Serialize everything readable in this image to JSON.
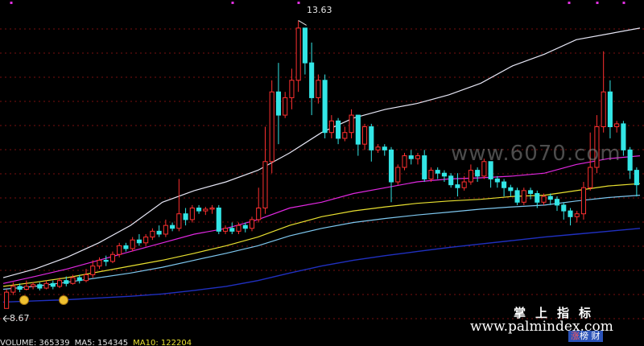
{
  "chart_data": {
    "type": "candlestick",
    "title": "",
    "xlabel": "",
    "ylabel": "",
    "ylim": [
      8.3,
      13.9
    ],
    "price_labels": {
      "high": "13.63",
      "low": "8.67"
    },
    "colors": {
      "up": "#ff3030",
      "down": "#33e6e6",
      "ma_white": "#e6e6f5",
      "ma_magenta": "#e028e0",
      "ma_yellow": "#e8e030",
      "ma_lightblue": "#7ec8f0",
      "ma_navy": "#2030c0",
      "grid": "#7a1010",
      "marker": "#e030e0"
    },
    "candles": [
      [
        8.67,
        8.95,
        8.67,
        9.0
      ],
      [
        8.95,
        9.05,
        8.9,
        9.12
      ],
      [
        9.05,
        9.0,
        8.95,
        9.1
      ],
      [
        9.0,
        9.05,
        8.98,
        9.15
      ],
      [
        9.05,
        9.08,
        9.0,
        9.12
      ],
      [
        9.08,
        9.02,
        8.98,
        9.12
      ],
      [
        9.02,
        9.1,
        9.0,
        9.15
      ],
      [
        9.1,
        9.05,
        9.0,
        9.15
      ],
      [
        9.05,
        9.15,
        9.02,
        9.2
      ],
      [
        9.15,
        9.1,
        9.05,
        9.22
      ],
      [
        9.1,
        9.2,
        9.08,
        9.25
      ],
      [
        9.2,
        9.15,
        9.1,
        9.25
      ],
      [
        9.15,
        9.25,
        9.12,
        9.35
      ],
      [
        9.25,
        9.4,
        9.2,
        9.5
      ],
      [
        9.4,
        9.5,
        9.35,
        9.55
      ],
      [
        9.5,
        9.48,
        9.4,
        9.58
      ],
      [
        9.48,
        9.6,
        9.45,
        9.65
      ],
      [
        9.6,
        9.75,
        9.55,
        9.8
      ],
      [
        9.75,
        9.7,
        9.65,
        9.8
      ],
      [
        9.7,
        9.85,
        9.65,
        9.9
      ],
      [
        9.85,
        9.8,
        9.75,
        9.95
      ],
      [
        9.8,
        9.9,
        9.75,
        9.95
      ],
      [
        9.9,
        10.0,
        9.85,
        10.05
      ],
      [
        10.0,
        9.95,
        9.9,
        10.1
      ],
      [
        9.95,
        10.1,
        9.9,
        10.2
      ],
      [
        10.1,
        10.05,
        10.0,
        10.15
      ],
      [
        10.05,
        10.3,
        10.0,
        10.9
      ],
      [
        10.3,
        10.2,
        10.1,
        10.4
      ],
      [
        10.2,
        10.4,
        10.15,
        10.45
      ],
      [
        10.4,
        10.35,
        10.3,
        10.45
      ],
      [
        10.35,
        10.38,
        10.28,
        10.42
      ],
      [
        10.38,
        10.4,
        10.3,
        10.45
      ],
      [
        10.4,
        10.0,
        9.95,
        10.45
      ],
      [
        10.0,
        10.05,
        9.95,
        10.1
      ],
      [
        10.05,
        10.0,
        9.95,
        10.15
      ],
      [
        10.0,
        10.1,
        9.95,
        10.15
      ],
      [
        10.1,
        10.05,
        9.98,
        10.15
      ],
      [
        10.05,
        10.2,
        10.0,
        10.25
      ],
      [
        10.2,
        10.4,
        10.15,
        10.75
      ],
      [
        10.4,
        11.2,
        10.3,
        11.8
      ],
      [
        11.2,
        12.4,
        11.0,
        12.6
      ],
      [
        12.4,
        12.0,
        11.5,
        12.9
      ],
      [
        12.0,
        12.3,
        11.95,
        12.4
      ],
      [
        12.3,
        12.6,
        12.1,
        12.8
      ],
      [
        12.6,
        13.5,
        12.4,
        13.63
      ],
      [
        13.5,
        12.9,
        12.7,
        13.3
      ],
      [
        12.9,
        12.3,
        12.0,
        13.25
      ],
      [
        12.3,
        12.6,
        12.2,
        12.7
      ],
      [
        12.6,
        11.7,
        11.6,
        12.7
      ],
      [
        11.7,
        11.9,
        11.6,
        12.0
      ],
      [
        11.9,
        11.6,
        11.5,
        11.95
      ],
      [
        11.6,
        11.7,
        11.55,
        11.8
      ],
      [
        11.7,
        12.0,
        11.6,
        12.1
      ],
      [
        12.0,
        11.5,
        11.3,
        12.0
      ],
      [
        11.5,
        11.8,
        11.4,
        11.85
      ],
      [
        11.8,
        11.4,
        11.2,
        11.85
      ],
      [
        11.4,
        11.45,
        11.35,
        11.5
      ],
      [
        11.45,
        11.4,
        11.3,
        11.5
      ],
      [
        11.4,
        10.85,
        10.5,
        11.45
      ],
      [
        10.85,
        11.1,
        10.8,
        11.15
      ],
      [
        11.1,
        11.3,
        11.05,
        11.35
      ],
      [
        11.3,
        11.25,
        11.15,
        11.4
      ],
      [
        11.25,
        11.3,
        11.15,
        11.35
      ],
      [
        11.3,
        10.9,
        10.85,
        11.4
      ],
      [
        10.9,
        11.05,
        10.85,
        11.1
      ],
      [
        11.05,
        11.0,
        10.9,
        11.1
      ],
      [
        11.0,
        10.95,
        10.85,
        11.05
      ],
      [
        10.95,
        10.8,
        10.75,
        11.0
      ],
      [
        10.8,
        10.75,
        10.6,
        11.0
      ],
      [
        10.75,
        10.85,
        10.7,
        10.95
      ],
      [
        10.85,
        11.05,
        10.8,
        11.15
      ],
      [
        11.05,
        10.95,
        10.85,
        11.1
      ],
      [
        10.95,
        11.2,
        10.9,
        11.25
      ],
      [
        11.2,
        10.9,
        10.75,
        11.2
      ],
      [
        10.9,
        10.85,
        10.75,
        10.95
      ],
      [
        10.85,
        10.75,
        10.6,
        10.9
      ],
      [
        10.75,
        10.7,
        10.6,
        10.8
      ],
      [
        10.7,
        10.5,
        10.45,
        10.75
      ],
      [
        10.5,
        10.7,
        10.45,
        10.75
      ],
      [
        10.7,
        10.65,
        10.55,
        10.75
      ],
      [
        10.65,
        10.5,
        10.4,
        10.7
      ],
      [
        10.5,
        10.6,
        10.45,
        10.65
      ],
      [
        10.6,
        10.55,
        10.45,
        10.65
      ],
      [
        10.55,
        10.45,
        10.35,
        10.6
      ],
      [
        10.45,
        10.35,
        10.2,
        10.5
      ],
      [
        10.35,
        10.25,
        10.1,
        10.4
      ],
      [
        10.25,
        10.3,
        10.15,
        10.35
      ],
      [
        10.3,
        10.75,
        10.2,
        10.85
      ],
      [
        10.75,
        11.1,
        10.7,
        11.7
      ],
      [
        11.1,
        11.8,
        11.0,
        12.0
      ],
      [
        11.8,
        12.4,
        11.7,
        13.1
      ],
      [
        12.4,
        11.8,
        11.6,
        12.6
      ],
      [
        11.8,
        11.85,
        11.7,
        11.9
      ],
      [
        11.85,
        11.4,
        11.3,
        11.9
      ],
      [
        11.4,
        11.05,
        10.9,
        11.45
      ],
      [
        11.05,
        10.8,
        10.6,
        11.1
      ]
    ],
    "series": [
      {
        "values": [
          9.2,
          9.35,
          9.55,
          9.8,
          10.1,
          10.5,
          10.7,
          10.85,
          11.05,
          11.35,
          11.7,
          11.95,
          12.1,
          12.2,
          12.35,
          12.55,
          12.85,
          13.05,
          13.3,
          13.4,
          13.5
        ]
      },
      {
        "values": [
          9.1,
          9.22,
          9.35,
          9.5,
          9.65,
          9.8,
          9.95,
          10.05,
          10.2,
          10.4,
          10.5,
          10.65,
          10.75,
          10.85,
          10.9,
          10.92,
          10.95,
          11.0,
          11.15,
          11.25,
          11.3
        ]
      },
      {
        "values": [
          9.05,
          9.12,
          9.2,
          9.3,
          9.4,
          9.5,
          9.62,
          9.75,
          9.9,
          10.1,
          10.25,
          10.35,
          10.42,
          10.48,
          10.52,
          10.55,
          10.6,
          10.62,
          10.7,
          10.78,
          10.82
        ]
      },
      {
        "values": [
          9.0,
          9.05,
          9.12,
          9.2,
          9.28,
          9.38,
          9.5,
          9.62,
          9.75,
          9.92,
          10.05,
          10.15,
          10.22,
          10.28,
          10.33,
          10.38,
          10.42,
          10.45,
          10.52,
          10.58,
          10.62
        ]
      },
      {
        "values": [
          8.78,
          8.8,
          8.82,
          8.85,
          8.88,
          8.92,
          8.98,
          9.05,
          9.15,
          9.28,
          9.4,
          9.5,
          9.58,
          9.65,
          9.72,
          9.78,
          9.84,
          9.9,
          9.95,
          10.0,
          10.05
        ]
      }
    ],
    "markers_top": 6
  },
  "watermark": {
    "site_gray": "www.6070.com",
    "brand": "掌上指标",
    "site_white": "www.palmindex.com"
  },
  "bottom_bar": {
    "items": [
      {
        "text": "VOLUME: 365339",
        "color": "#e6e6e6"
      },
      {
        "text": "MA5: 154345",
        "color": "#e6e6e6"
      },
      {
        "text": "MA10: 122204",
        "color": "#e8e030"
      }
    ]
  },
  "tag": {
    "left": "涨",
    "right": "榜 财"
  }
}
